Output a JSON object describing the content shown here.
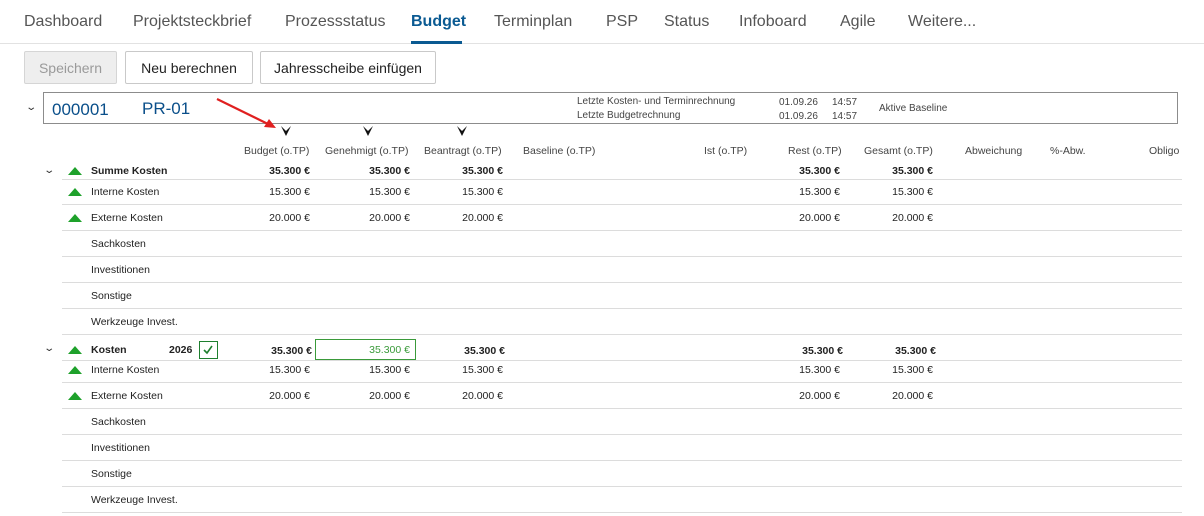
{
  "tabs": [
    {
      "label": "Dashboard"
    },
    {
      "label": "Projektsteckbrief"
    },
    {
      "label": "Prozessstatus"
    },
    {
      "label": "Budget"
    },
    {
      "label": "Terminplan"
    },
    {
      "label": "PSP"
    },
    {
      "label": "Status"
    },
    {
      "label": "Infoboard"
    },
    {
      "label": "Agile"
    },
    {
      "label": "Weitere..."
    }
  ],
  "active_tab": "Budget",
  "toolbar": {
    "save": "Speichern",
    "recalc": "Neu berechnen",
    "insert_year": "Jahresscheibe einfügen"
  },
  "project": {
    "id": "000001",
    "name": "PR-01",
    "last_cost_label": "Letzte Kosten- und Terminrechnung",
    "last_budget_label": "Letzte Budgetrechnung",
    "last_cost_date": "01.09.26",
    "last_cost_time": "14:57",
    "last_budget_date": "01.09.26",
    "last_budget_time": "14:57",
    "baseline": "Aktive Baseline"
  },
  "columns": {
    "budget": "Budget (o.TP)",
    "genehmigt": "Genehmigt (o.TP)",
    "beantragt": "Beantragt (o.TP)",
    "baseline": "Baseline (o.TP)",
    "ist": "Ist (o.TP)",
    "rest": "Rest (o.TP)",
    "gesamt": "Gesamt (o.TP)",
    "abweichung": "Abweichung",
    "pct_abw": "%-Abw.",
    "obligo": "Obligo"
  },
  "summary": {
    "label": "Summe Kosten",
    "budget": "35.300 €",
    "genehmigt": "35.300 €",
    "beantragt": "35.300 €",
    "rest": "35.300 €",
    "gesamt": "35.300 €",
    "rows": [
      {
        "label": "Interne Kosten",
        "budget": "15.300 €",
        "genehmigt": "15.300 €",
        "beantragt": "15.300 €",
        "rest": "15.300 €",
        "gesamt": "15.300 €"
      },
      {
        "label": "Externe Kosten",
        "budget": "20.000 €",
        "genehmigt": "20.000 €",
        "beantragt": "20.000 €",
        "rest": "20.000 €",
        "gesamt": "20.000 €"
      },
      {
        "label": "Sachkosten"
      },
      {
        "label": "Investitionen"
      },
      {
        "label": "Sonstige"
      },
      {
        "label": "Werkzeuge Invest."
      }
    ]
  },
  "year_section": {
    "label": "Kosten",
    "year": "2026",
    "budget": "35.300 €",
    "genehmigt_edit": "35.300 €",
    "beantragt": "35.300 €",
    "rest": "35.300 €",
    "gesamt": "35.300 €",
    "rows": [
      {
        "label": "Interne Kosten",
        "budget": "15.300 €",
        "genehmigt": "15.300 €",
        "beantragt": "15.300 €",
        "rest": "15.300 €",
        "gesamt": "15.300 €"
      },
      {
        "label": "Externe Kosten",
        "budget": "20.000 €",
        "genehmigt": "20.000 €",
        "beantragt": "20.000 €",
        "rest": "20.000 €",
        "gesamt": "20.000 €"
      },
      {
        "label": "Sachkosten"
      },
      {
        "label": "Investitionen"
      },
      {
        "label": "Sonstige"
      },
      {
        "label": "Werkzeuge Invest."
      }
    ]
  },
  "colors": {
    "accent": "#0a5a92",
    "green": "#1ea12b",
    "annotation_arrow": "#e02020"
  },
  "icons": [
    "chevron-down-icon",
    "filter-icon",
    "triangle-up-icon",
    "checkmark-icon",
    "annotation-arrow"
  ]
}
